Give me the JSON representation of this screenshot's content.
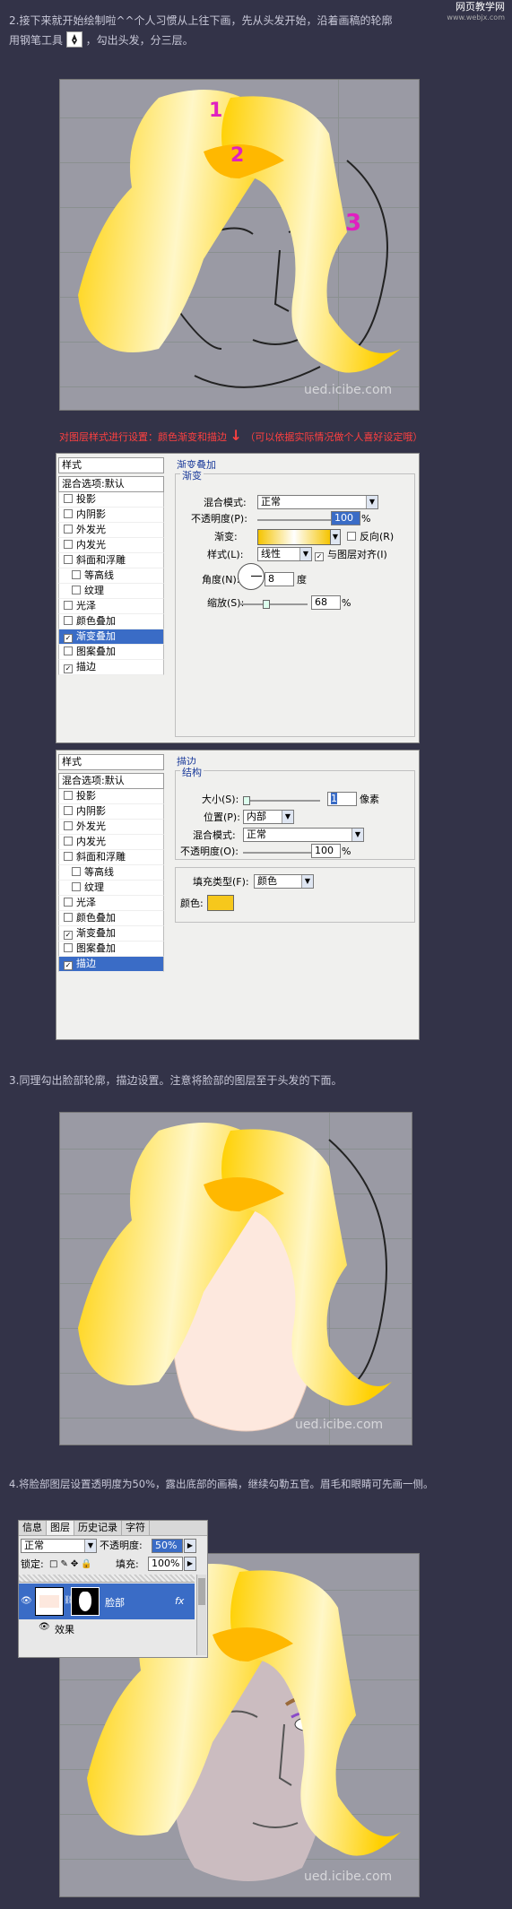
{
  "watermark": {
    "title": "网页教学网",
    "url": "www.webjx.com"
  },
  "step2": {
    "text_line1": "2.接下来就开始绘制啦^^个人习惯从上往下画，先从头发开始，沿着画稿的轮廓",
    "text_line2_before": "用钢笔工具",
    "text_line2_after": "，勾出头发，分三层。",
    "labels": [
      "1",
      "2",
      "3"
    ],
    "pic_watermark": "ued.icibe.com"
  },
  "style_note": {
    "text": "对图层样式进行设置：颜色渐变和描边",
    "arrow": "↓",
    "paren": "（可以依据实际情况做个人喜好设定哦）"
  },
  "dialog1": {
    "styles_label": "样式",
    "blend_default": "混合选项:默认",
    "items": [
      {
        "label": "投影",
        "checked": false,
        "sub": false,
        "selected": false
      },
      {
        "label": "内阴影",
        "checked": false,
        "sub": false,
        "selected": false
      },
      {
        "label": "外发光",
        "checked": false,
        "sub": false,
        "selected": false
      },
      {
        "label": "内发光",
        "checked": false,
        "sub": false,
        "selected": false
      },
      {
        "label": "斜面和浮雕",
        "checked": false,
        "sub": false,
        "selected": false
      },
      {
        "label": "等高线",
        "checked": false,
        "sub": true,
        "selected": false
      },
      {
        "label": "纹理",
        "checked": false,
        "sub": true,
        "selected": false
      },
      {
        "label": "光泽",
        "checked": false,
        "sub": false,
        "selected": false
      },
      {
        "label": "颜色叠加",
        "checked": false,
        "sub": false,
        "selected": false
      },
      {
        "label": "渐变叠加",
        "checked": true,
        "sub": false,
        "selected": true
      },
      {
        "label": "图案叠加",
        "checked": false,
        "sub": false,
        "selected": false
      },
      {
        "label": "描边",
        "checked": true,
        "sub": false,
        "selected": false
      }
    ],
    "section_title": "渐变叠加",
    "group_title": "渐变",
    "blend_mode_label": "混合模式:",
    "blend_mode_value": "正常",
    "opacity_label": "不透明度(P):",
    "opacity_value": "100",
    "percent": "%",
    "gradient_label": "渐变:",
    "reverse_label": "反向(R)",
    "style_label": "样式(L):",
    "style_value": "线性",
    "align_label": "与图层对齐(I)",
    "angle_label": "角度(N):",
    "angle_value": "8",
    "degree": "度",
    "scale_label": "缩放(S):",
    "scale_value": "68",
    "gradient_colors": [
      "#f5c400",
      "#ffffff",
      "#f5c400"
    ]
  },
  "dialog2": {
    "styles_label": "样式",
    "blend_default": "混合选项:默认",
    "items": [
      {
        "label": "投影",
        "checked": false,
        "sub": false,
        "selected": false
      },
      {
        "label": "内阴影",
        "checked": false,
        "sub": false,
        "selected": false
      },
      {
        "label": "外发光",
        "checked": false,
        "sub": false,
        "selected": false
      },
      {
        "label": "内发光",
        "checked": false,
        "sub": false,
        "selected": false
      },
      {
        "label": "斜面和浮雕",
        "checked": false,
        "sub": false,
        "selected": false
      },
      {
        "label": "等高线",
        "checked": false,
        "sub": true,
        "selected": false
      },
      {
        "label": "纹理",
        "checked": false,
        "sub": true,
        "selected": false
      },
      {
        "label": "光泽",
        "checked": false,
        "sub": false,
        "selected": false
      },
      {
        "label": "颜色叠加",
        "checked": false,
        "sub": false,
        "selected": false
      },
      {
        "label": "渐变叠加",
        "checked": true,
        "sub": false,
        "selected": false
      },
      {
        "label": "图案叠加",
        "checked": false,
        "sub": false,
        "selected": false
      },
      {
        "label": "描边",
        "checked": true,
        "sub": false,
        "selected": true
      }
    ],
    "section_title": "描边",
    "group_title": "结构",
    "size_label": "大小(S):",
    "size_value": "1",
    "px": "像素",
    "position_label": "位置(P):",
    "position_value": "内部",
    "blend_mode_label": "混合模式:",
    "blend_mode_value": "正常",
    "opacity_label": "不透明度(O):",
    "opacity_value": "100",
    "percent": "%",
    "fill_type_label": "填充类型(F):",
    "fill_type_value": "颜色",
    "color_label": "颜色:",
    "stroke_color": "#f6c81c"
  },
  "step3": {
    "text": "3.同理勾出脸部轮廓，描边设置。注意将脸部的图层至于头发的下面。",
    "pic_watermark": "ued.icibe.com"
  },
  "step4": {
    "text": "4.将脸部图层设置透明度为50%，露出底部的画稿，继续勾勒五官。眉毛和眼睛可先画一侧。",
    "pic_watermark": "ued.icibe.com"
  },
  "layers_panel": {
    "tabs": [
      "信息",
      "图层",
      "历史记录",
      "字符"
    ],
    "active_tab": "图层",
    "blend_value": "正常",
    "opacity_label": "不透明度:",
    "opacity_value": "50%",
    "lock_label": "锁定:",
    "fill_label": "填充:",
    "fill_value": "100%",
    "layer_name": "脸部",
    "fx": "fx",
    "effects_label": "效果"
  },
  "colors": {
    "background": "#333348",
    "hair_yellow": "#ffd21e",
    "face": "#fde8de",
    "selection": "#3a6cc6",
    "note_red": "#ff4040"
  }
}
